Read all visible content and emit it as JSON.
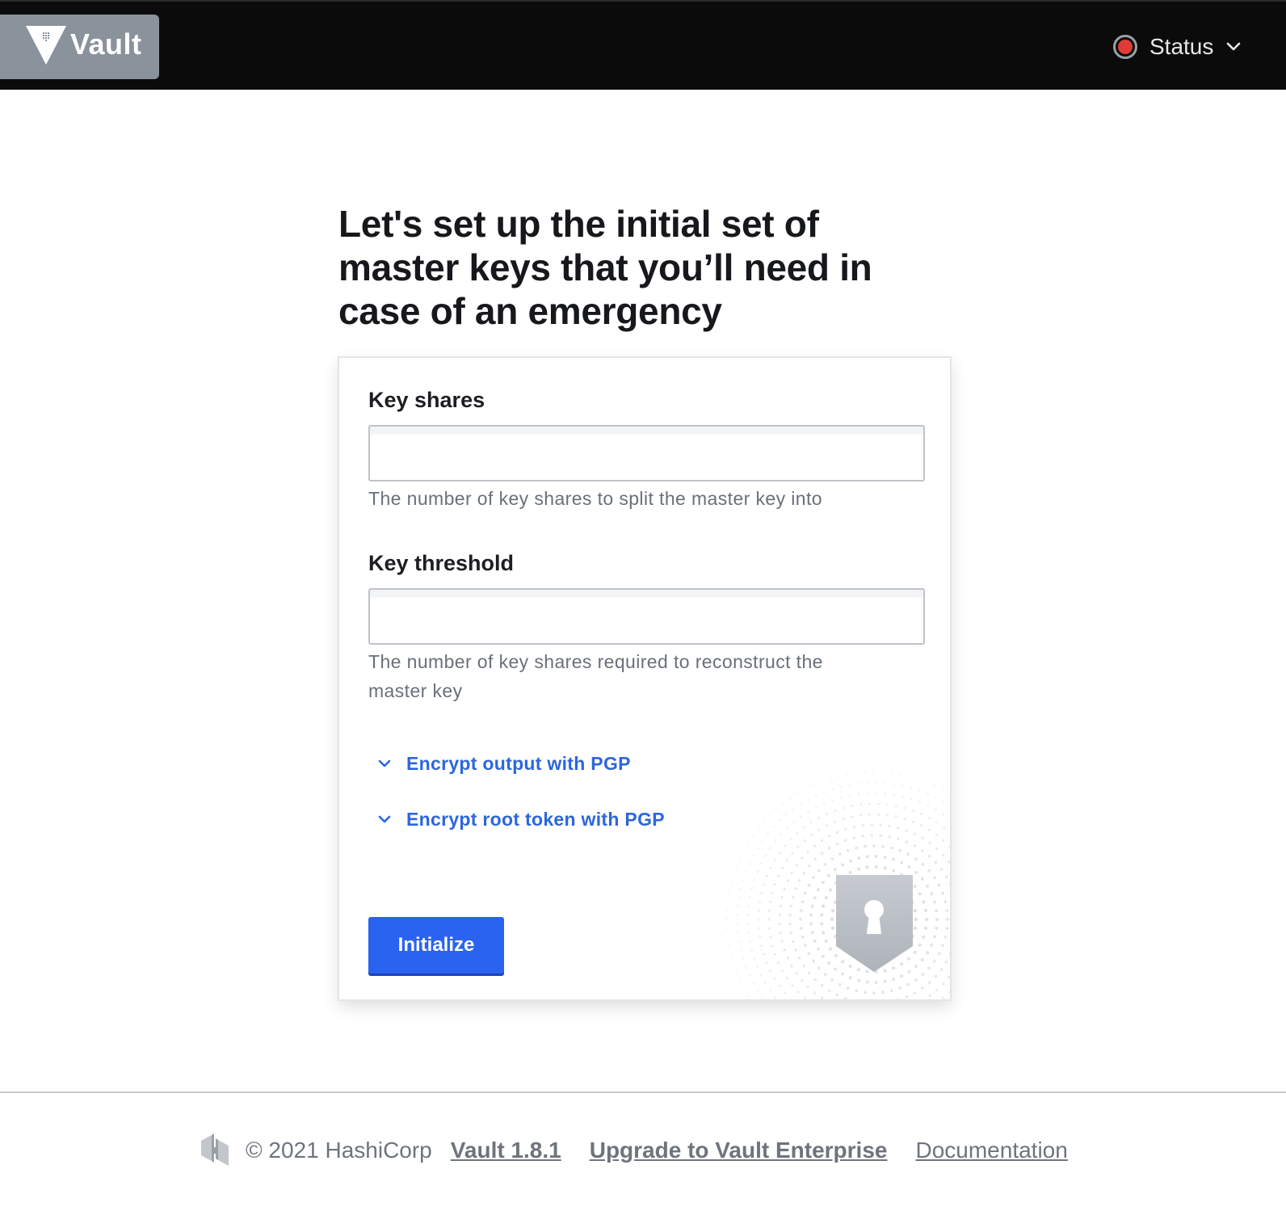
{
  "header": {
    "app_name": "Vault",
    "logo_icon": "vault-triangle-icon",
    "status": {
      "label": "Status",
      "indicator_color": "#e23b36",
      "icon": "chevron-down-icon"
    }
  },
  "page": {
    "title": "Let's set up the initial set of master keys that you’ll need in case of an emergency"
  },
  "form": {
    "key_shares": {
      "label": "Key shares",
      "value": "",
      "help": "The number of key shares to split the master key into"
    },
    "key_threshold": {
      "label": "Key threshold",
      "value": "",
      "help": "The number of key shares required to reconstruct the master key"
    },
    "toggles": [
      {
        "label": "Encrypt output with PGP",
        "icon": "chevron-down-icon"
      },
      {
        "label": "Encrypt root token with PGP",
        "icon": "chevron-down-icon"
      }
    ],
    "submit_label": "Initialize",
    "illustration_icon": "keyhole-shield-icon"
  },
  "footer": {
    "logo_icon": "hashicorp-logo-icon",
    "copyright": "© 2021 HashiCorp",
    "links": [
      "Vault 1.8.1",
      "Upgrade to Vault Enterprise",
      "Documentation"
    ]
  },
  "colors": {
    "header_bg": "#0b0b0c",
    "accent": "#2a63f0",
    "link": "#2d66dd"
  }
}
